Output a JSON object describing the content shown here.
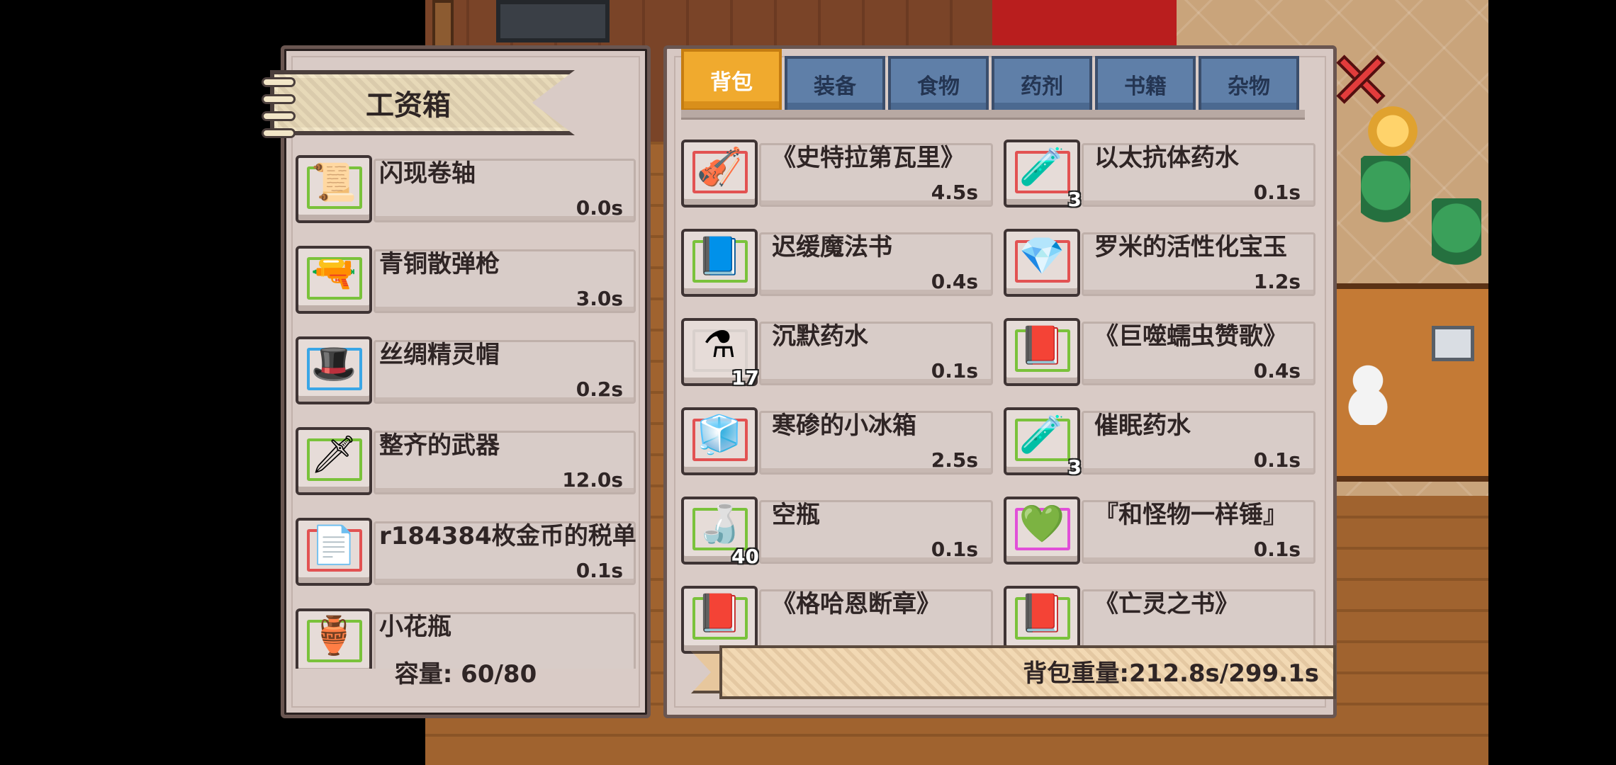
{
  "left_panel": {
    "title": "工资箱",
    "capacity": "容量: 60/80",
    "items": [
      {
        "name": "闪现卷轴",
        "weight": "0.0s",
        "icon": "scroll-icon",
        "glyph": "📜",
        "frame": "green"
      },
      {
        "name": "青铜散弹枪",
        "weight": "3.0s",
        "icon": "shotgun-icon",
        "glyph": "🔫",
        "frame": "green"
      },
      {
        "name": "丝绸精灵帽",
        "weight": "0.2s",
        "icon": "wizard-hat-icon",
        "glyph": "🎩",
        "frame": "blue"
      },
      {
        "name": "整齐的武器",
        "weight": "12.0s",
        "icon": "weapon-rack-icon",
        "glyph": "🗡",
        "frame": "green"
      },
      {
        "name": "r184384枚金币的税单",
        "weight": "0.1s",
        "icon": "tax-bill-icon",
        "glyph": "📄",
        "frame": "red"
      },
      {
        "name": "小花瓶",
        "weight": "",
        "icon": "flower-vase-icon",
        "glyph": "🏺",
        "frame": "green"
      }
    ]
  },
  "right_panel": {
    "tabs": [
      {
        "label": "背包",
        "active": true
      },
      {
        "label": "装备",
        "active": false
      },
      {
        "label": "食物",
        "active": false
      },
      {
        "label": "药剂",
        "active": false
      },
      {
        "label": "书籍",
        "active": false
      },
      {
        "label": "杂物",
        "active": false
      }
    ],
    "items": [
      {
        "name": "《史特拉第瓦里》",
        "weight": "4.5s",
        "count": "",
        "icon": "violin-icon",
        "glyph": "🎻",
        "frame": "red"
      },
      {
        "name": "以太抗体药水",
        "weight": "0.1s",
        "count": "3",
        "icon": "potion-purple-icon",
        "glyph": "🧪",
        "frame": "red"
      },
      {
        "name": "迟缓魔法书",
        "weight": "0.4s",
        "count": "",
        "icon": "blue-spellbook-icon",
        "glyph": "📘",
        "frame": "green"
      },
      {
        "name": "罗米的活性化宝玉",
        "weight": "1.2s",
        "count": "",
        "icon": "green-gem-icon",
        "glyph": "💎",
        "frame": "red"
      },
      {
        "name": "沉默药水",
        "weight": "0.1s",
        "count": "17",
        "icon": "potion-clear-icon",
        "glyph": "⚗",
        "frame": "white"
      },
      {
        "name": "《巨噬蠕虫赞歌》",
        "weight": "0.4s",
        "count": "",
        "icon": "purple-book-icon",
        "glyph": "📕",
        "frame": "green"
      },
      {
        "name": "寒碜的小冰箱",
        "weight": "2.5s",
        "count": "",
        "icon": "mini-fridge-icon",
        "glyph": "🧊",
        "frame": "red"
      },
      {
        "name": "催眠药水",
        "weight": "0.1s",
        "count": "3",
        "icon": "potion-violet-icon",
        "glyph": "🧪",
        "frame": "green"
      },
      {
        "name": "空瓶",
        "weight": "0.1s",
        "count": "40",
        "icon": "empty-bottle-icon",
        "glyph": "🍶",
        "frame": "green"
      },
      {
        "name": "『和怪物一样锤』",
        "weight": "0.1s",
        "count": "",
        "icon": "green-gem-necklace-icon",
        "glyph": "💚",
        "frame": "pink"
      },
      {
        "name": "《格哈恩断章》",
        "weight": "",
        "count": "",
        "icon": "purple-book-icon",
        "glyph": "📕",
        "frame": "green"
      },
      {
        "name": "《亡灵之书》",
        "weight": "",
        "count": "",
        "icon": "purple-book-icon",
        "glyph": "📕",
        "frame": "green"
      }
    ],
    "weight_label": "背包重量:212.8s/299.1s"
  },
  "close_button": {
    "icon": "close-icon"
  },
  "colors": {
    "panel_bg": "#d7c8c3",
    "active_tab": "#f0aa2e",
    "inactive_tab": "#5f7fa8",
    "frame_green": "#7ac23b",
    "frame_red": "#e25252",
    "frame_blue": "#3aa6e6",
    "frame_pink": "#e14fd8",
    "close_red": "#e23c3c"
  }
}
